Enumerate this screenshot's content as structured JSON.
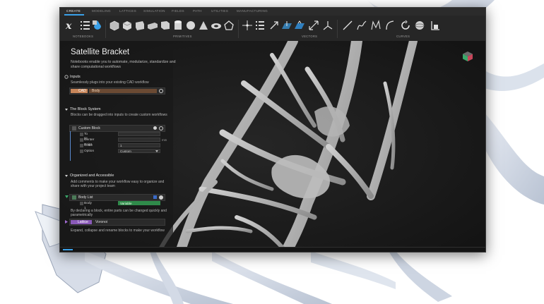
{
  "tabs": [
    "CREATE",
    "MODELING",
    "LATTICES",
    "SIMULATION",
    "FIELDS",
    "PATH",
    "UTILITIES",
    "MANUFACTURING"
  ],
  "toolbar": {
    "groups": [
      "NOTEBOOKS",
      "PRIMITIVES",
      "VECTORS",
      "CURVES"
    ],
    "icons": [
      "variable-x-icon",
      "list-icon",
      "drop-icon",
      "box-icon",
      "cube-icon",
      "cube-alt-icon",
      "block-icon",
      "slab-icon",
      "cylinder-icon",
      "sphere-icon",
      "cone-icon",
      "torus-icon",
      "pentagon-icon",
      "point-icon",
      "list-numbers-icon",
      "arrow-icon",
      "plane-icon",
      "resize-icon",
      "axes-icon",
      "line-icon",
      "curve-icon",
      "spline-icon",
      "arc-icon",
      "circle-icon",
      "bar-chart-icon"
    ]
  },
  "panel": {
    "title": "Satellite Bracket",
    "description": "Notebooks enable you to automate, modularize, standardize and share computational workflows",
    "inputs": {
      "heading": "Inputs",
      "text": "Seamlessly plugs into your existing CAD workflow",
      "block_tag": "CAD",
      "block_label": "Body"
    },
    "block_system": {
      "heading": "The Block System",
      "text": "Blocks can be dragged into inputs to create custom workflows",
      "block_label": "Custom Block",
      "rows": [
        {
          "label": "To fill",
          "value": ""
        },
        {
          "label": "Center Point",
          "value": ""
        },
        {
          "label": "Scale",
          "value": "1"
        },
        {
          "label": "Option",
          "value": "Custom"
        }
      ],
      "units": "mm"
    },
    "organized": {
      "heading": "Organized and Accessible",
      "text": "Add comments to make your workflow easy to organize and share with your project team",
      "list_label": "Body List",
      "list_item": "Body 1",
      "list_item_value": "Variable",
      "text2": "By declaring a block, entire parts can be changed quickly and parametrically",
      "lattice_label": "Lattice",
      "lattice_value": "Voronoi",
      "text3": "Expand, collapse and rename blocks to make your workflow"
    }
  },
  "colors": {
    "accent": "#3aa0e8",
    "cad": "#c8865a",
    "lattice": "#8a5ab8",
    "variable": "#2f8a4a"
  }
}
